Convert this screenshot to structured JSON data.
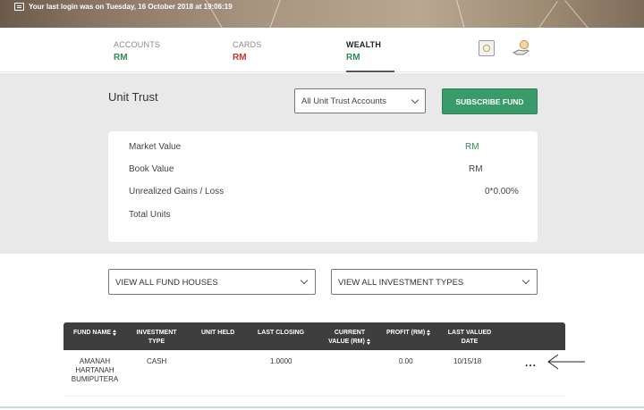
{
  "banner": {
    "last_login": "Your last login was on Tuesday, 16 October 2018 at 19:06:19"
  },
  "nav": {
    "tabs": [
      {
        "label": "ACCOUNTS",
        "value": "RM"
      },
      {
        "label": "CARDS",
        "value": "RM"
      },
      {
        "label": "WEALTH",
        "value": "RM"
      }
    ],
    "active_tab": "WEALTH"
  },
  "unit_trust": {
    "title": "Unit Trust",
    "account_select": "All Unit Trust Accounts",
    "subscribe_label": "SUBSCRIBE FUND"
  },
  "summary": {
    "market_value": {
      "label": "Market Value",
      "value": "RM"
    },
    "book_value": {
      "label": "Book Value",
      "value": "RM"
    },
    "unrealized": {
      "label": "Unrealized Gains / Loss",
      "value": "0*0.00%"
    },
    "total_units": {
      "label": "Total Units",
      "value": ""
    }
  },
  "filters": {
    "fund_houses": "VIEW ALL FUND HOUSES",
    "investment_types": "VIEW ALL INVESTMENT TYPES"
  },
  "table": {
    "headers": {
      "fund_name": "FUND NAME",
      "investment_type_1": "INVESTMENT",
      "investment_type_2": "TYPE",
      "unit_held": "UNIT HELD",
      "last_closing": "LAST CLOSING",
      "current_value_1": "CURRENT",
      "current_value_2": "VALUE (RM)",
      "profit": "PROFIT (RM)",
      "last_valued_1": "LAST VALUED",
      "last_valued_2": "DATE"
    },
    "rows": [
      {
        "fund_name_1": "AMANAH",
        "fund_name_2": "HARTANAH",
        "fund_name_3": "BUMIPUTERA",
        "investment_type": "CASH",
        "unit_held": "",
        "last_closing": "1.0000",
        "current_value": "",
        "profit": "0.00",
        "last_valued_date": "10/15/18",
        "more": "..."
      }
    ]
  },
  "icons": {
    "banner": "computer-icon",
    "safe": "safe-icon",
    "money": "money-hand-icon",
    "dropdown": "chevron-down-icon",
    "sort": "sort-icon",
    "annotation": "arrow-left-icon"
  },
  "colors": {
    "accent_green": "#3a9b6a",
    "positive": "#2e8b57",
    "negative": "#d0312d",
    "header_dark": "#3e3e3e",
    "section_grey": "#e9e9e9"
  }
}
